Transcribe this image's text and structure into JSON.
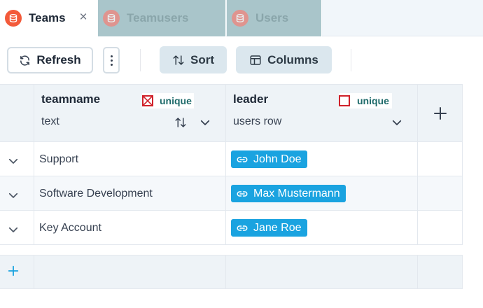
{
  "tabs": [
    {
      "label": "Teams",
      "active": true,
      "icon": "database-icon"
    },
    {
      "label": "Teamusers",
      "active": false,
      "icon": "database-icon"
    },
    {
      "label": "Users",
      "active": false,
      "icon": "database-icon"
    }
  ],
  "toolbar": {
    "refresh_label": "Refresh",
    "sort_label": "Sort",
    "columns_label": "Columns"
  },
  "columns": [
    {
      "name": "teamname",
      "type": "text",
      "unique_label": "unique",
      "unique_checked": true
    },
    {
      "name": "leader",
      "type": "users row",
      "unique_label": "unique",
      "unique_checked": false
    }
  ],
  "rows": [
    {
      "teamname": "Support",
      "leader": "John Doe"
    },
    {
      "teamname": "Software Development",
      "leader": "Max Mustermann"
    },
    {
      "teamname": "Key Account",
      "leader": "Jane Roe"
    }
  ],
  "colors": {
    "accent": "#f35a3a",
    "chip": "#1aa3e0",
    "unique_checkbox": "#d0212a",
    "inactive_tab": "#a9c5ca"
  }
}
